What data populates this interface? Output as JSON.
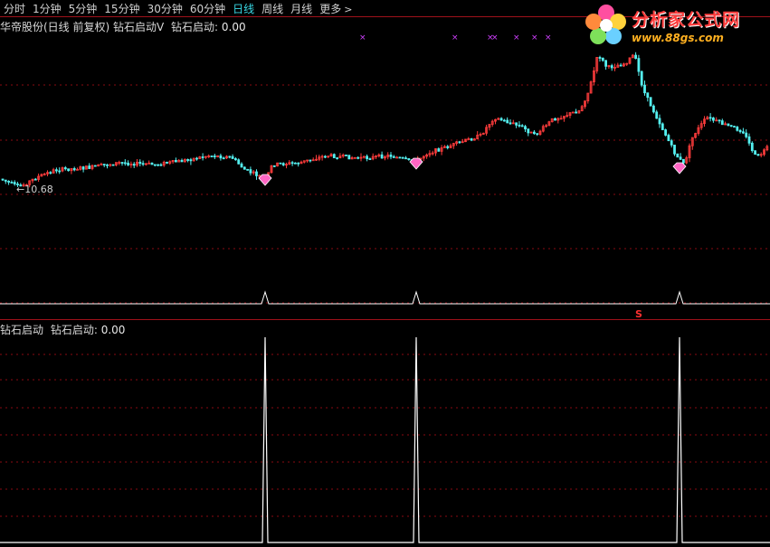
{
  "toolbar": {
    "tabs": [
      {
        "label": "分时"
      },
      {
        "label": "1分钟"
      },
      {
        "label": "5分钟"
      },
      {
        "label": "15分钟"
      },
      {
        "label": "30分钟"
      },
      {
        "label": "60分钟"
      },
      {
        "label": "日线"
      },
      {
        "label": "周线"
      },
      {
        "label": "月线"
      },
      {
        "label": "更多"
      }
    ],
    "active_tab": "日线",
    "more_icon": "chevron-right-icon"
  },
  "main_panel": {
    "title": "华帝股份(日线 前复权) 钻石启动V",
    "indicator_label": "钻石启动:",
    "indicator_value": "0.00",
    "price_marker": "10.68"
  },
  "sub_panel": {
    "title": "钻石启动",
    "indicator_label": "钻石启动:",
    "indicator_value": "0.00",
    "signal_mark": "S"
  },
  "watermark": {
    "name": "分析家公式网",
    "url": "www.88gs.com"
  },
  "colors": {
    "up_candle": "#ff3c3c",
    "down_candle": "#54f0f0",
    "grid": "#8a0a12",
    "signal": "#ffffff",
    "diamond": "#ff66c4",
    "cross_marker": "#d040ff"
  },
  "chart_data": {
    "type": "candlestick",
    "signal_bars": [
      98,
      155,
      255
    ],
    "diamond_icon": "diamond-icon",
    "cross_marker_icon": "x-marker-icon"
  }
}
